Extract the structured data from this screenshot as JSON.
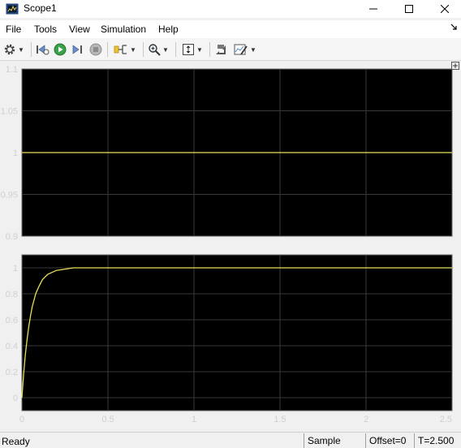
{
  "window": {
    "title": "Scope1",
    "minimize_icon": "minimize-icon",
    "maximize_icon": "maximize-icon",
    "close_icon": "close-icon"
  },
  "menu": {
    "items": [
      "File",
      "Tools",
      "View",
      "Simulation",
      "Help"
    ]
  },
  "toolbar": {
    "icons": [
      "gear-icon",
      "step-back-icon",
      "run-icon",
      "step-forward-icon",
      "stop-icon",
      "highlight-signal-icon",
      "zoom-icon",
      "autoscale-icon",
      "write-data-icon",
      "edit-style-icon"
    ]
  },
  "status": {
    "ready": "Ready",
    "sample": "Sample based",
    "offset": "Offset=0",
    "time": "T=2.500"
  },
  "colors": {
    "plot_background": "#000000",
    "trace": "#e6e05a",
    "grid": "#3a3a3a",
    "tick_text": "#cfcfcf"
  },
  "chart_data": [
    {
      "type": "line",
      "xlim": [
        0,
        2.5
      ],
      "ylim": [
        0.9,
        1.1
      ],
      "x_ticks": [],
      "y_ticks": [
        "0.9",
        "0.95",
        "1",
        "1.05",
        "1.1"
      ],
      "y_tick_values": [
        0.9,
        0.95,
        1,
        1.05,
        1.1
      ],
      "grid": true,
      "series": [
        {
          "x": [
            0,
            2.5
          ],
          "y": [
            1,
            1
          ]
        }
      ]
    },
    {
      "type": "line",
      "xlim": [
        0,
        2.5
      ],
      "ylim": [
        -0.1,
        1.1
      ],
      "x_ticks": [
        "0",
        "0.5",
        "1",
        "1.5",
        "2",
        "2.5"
      ],
      "x_tick_values": [
        0,
        0.5,
        1,
        1.5,
        2,
        2.5
      ],
      "y_ticks": [
        "0",
        "0.2",
        "0.4",
        "0.6",
        "0.8",
        "1"
      ],
      "y_tick_values": [
        0,
        0.2,
        0.4,
        0.6,
        0.8,
        1
      ],
      "grid": true,
      "series": [
        {
          "x": [
            0,
            0.01,
            0.02,
            0.03,
            0.04,
            0.05,
            0.06,
            0.08,
            0.1,
            0.12,
            0.15,
            0.2,
            0.25,
            0.3,
            0.4,
            0.5,
            1,
            1.5,
            2,
            2.5
          ],
          "y": [
            0,
            0.18,
            0.33,
            0.45,
            0.55,
            0.63,
            0.7,
            0.8,
            0.86,
            0.91,
            0.95,
            0.98,
            0.99,
            1,
            1,
            1,
            1,
            1,
            1,
            1
          ]
        }
      ]
    }
  ]
}
